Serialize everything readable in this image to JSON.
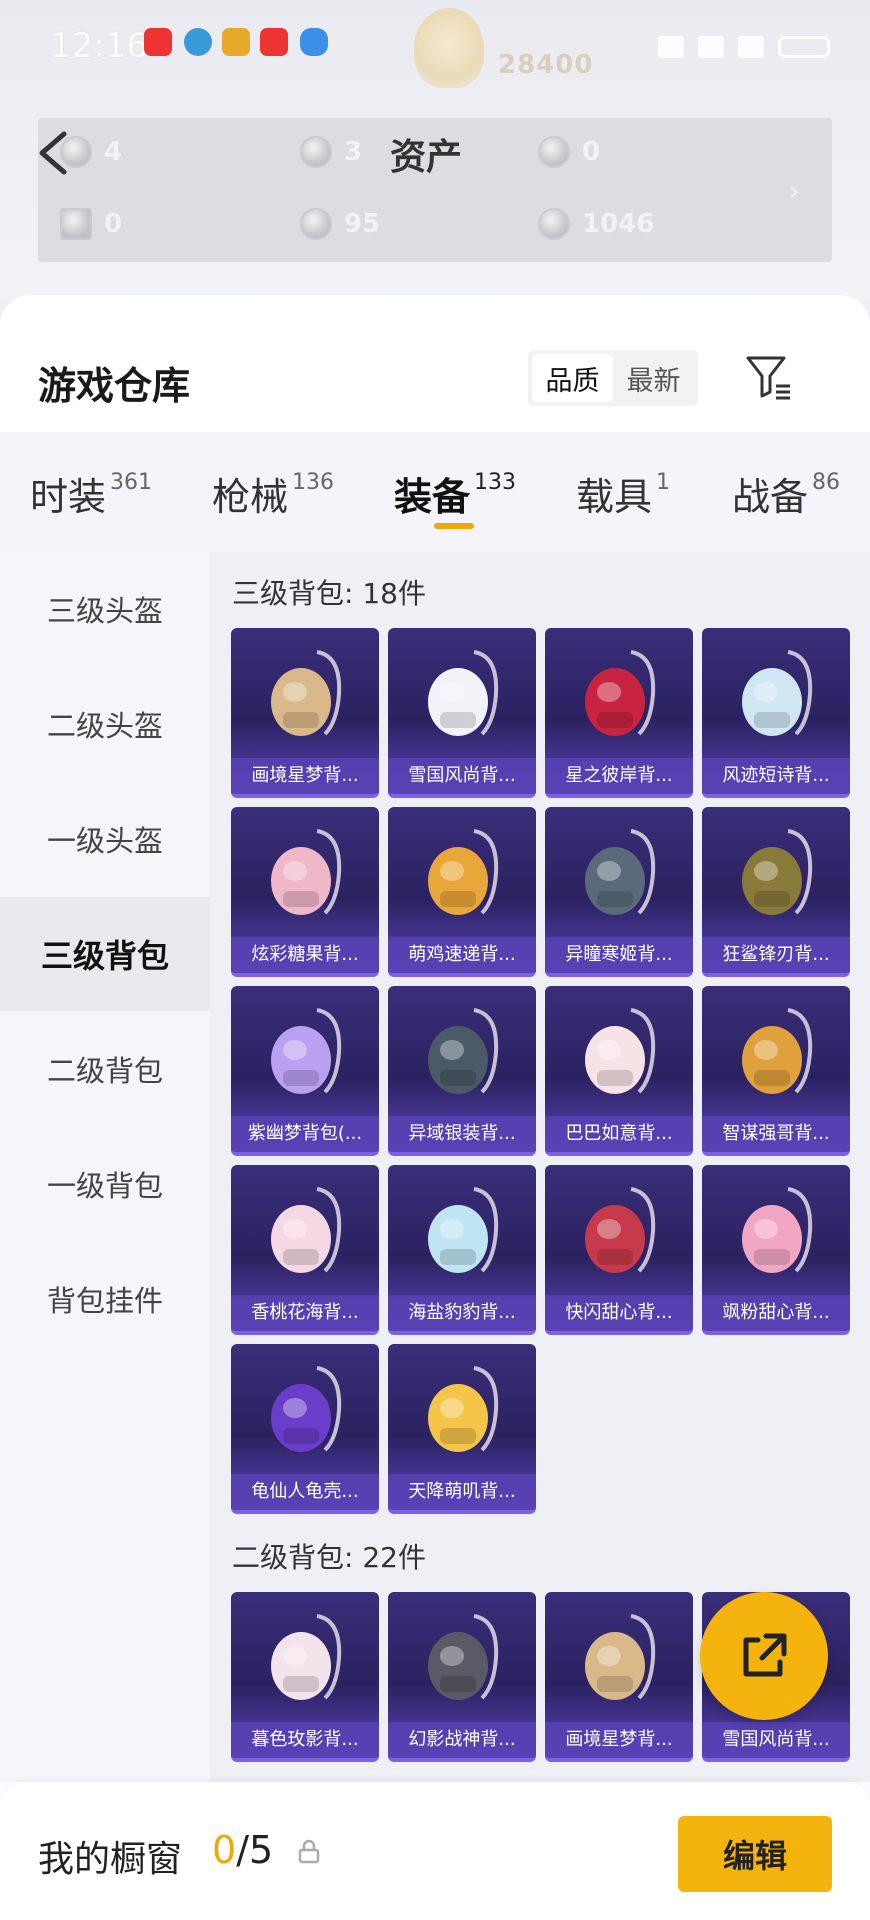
{
  "status_bar": {
    "time": "12:16",
    "score": "28400"
  },
  "assets": {
    "title": "资产",
    "items": [
      {
        "value": "4"
      },
      {
        "value": "3"
      },
      {
        "value": "0"
      },
      {
        "value": "0"
      },
      {
        "value": "95"
      },
      {
        "value": "1046"
      }
    ]
  },
  "warehouse": {
    "title": "游戏仓库",
    "sort_options": [
      "品质",
      "最新"
    ]
  },
  "categories": [
    {
      "label": "时装",
      "count": "361"
    },
    {
      "label": "枪械",
      "count": "136"
    },
    {
      "label": "装备",
      "count": "133"
    },
    {
      "label": "载具",
      "count": "1"
    },
    {
      "label": "战备",
      "count": "86"
    }
  ],
  "subcategories": [
    "三级头盔",
    "二级头盔",
    "一级头盔",
    "三级背包",
    "二级背包",
    "一级背包",
    "背包挂件"
  ],
  "groups": [
    {
      "title": "三级背包: 18件",
      "items": [
        "画境星梦背...",
        "雪国风尚背...",
        "星之彼岸背...",
        "风迹短诗背...",
        "炫彩糖果背...",
        "萌鸡速递背...",
        "异瞳寒姬背...",
        "狂鲨锋刃背...",
        "紫幽梦背包(...",
        "异域银装背...",
        "巴巴如意背...",
        "智谋强哥背...",
        "香桃花海背...",
        "海盐豹豹背...",
        "快闪甜心背...",
        "飒粉甜心背...",
        "龟仙人龟壳...",
        "天降萌叽背..."
      ]
    },
    {
      "title": "二级背包: 22件",
      "items": [
        "暮色玫影背...",
        "幻影战神背...",
        "画境星梦背...",
        "雪国风尚背..."
      ]
    }
  ],
  "bottom": {
    "showcase_label": "我的橱窗",
    "showcase_current": "0",
    "showcase_total": "/5",
    "edit_label": "编辑"
  },
  "colors": {
    "accent": "#f5b40d",
    "card_top": "#3b2e7a",
    "card_bottom": "#5c43b8"
  }
}
